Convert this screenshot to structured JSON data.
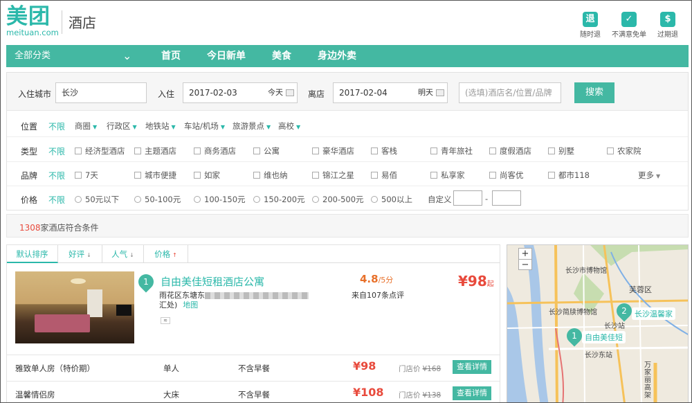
{
  "header": {
    "logo_cn": "美团",
    "logo_en": "meituan.com",
    "title": "酒店",
    "icons": [
      {
        "glyph": "退",
        "label": "随时退",
        "icon": "refund-icon"
      },
      {
        "glyph": "✓",
        "label": "不满意免单",
        "icon": "check-icon"
      },
      {
        "glyph": "$",
        "label": "过期退",
        "icon": "expire-refund-icon"
      }
    ]
  },
  "nav": {
    "all_label": "全部分类",
    "links": [
      "首页",
      "今日新单",
      "美食",
      "身边外卖"
    ]
  },
  "search": {
    "city_label": "入住城市",
    "city_value": "长沙",
    "checkin_label": "入住",
    "checkin_value": "2017-02-03",
    "checkin_tag": "今天",
    "checkout_label": "离店",
    "checkout_value": "2017-02-04",
    "checkout_tag": "明天",
    "keyword_placeholder": "(选填)酒店名/位置/品牌",
    "button": "搜索"
  },
  "filters": {
    "all_label": "不限",
    "location": {
      "label": "位置",
      "options": [
        "商圈",
        "行政区",
        "地铁站",
        "车站/机场",
        "旅游景点",
        "高校"
      ]
    },
    "type": {
      "label": "类型",
      "options": [
        "经济型酒店",
        "主题酒店",
        "商务酒店",
        "公寓",
        "豪华酒店",
        "客栈",
        "青年旅社",
        "度假酒店",
        "别墅",
        "农家院"
      ]
    },
    "brand": {
      "label": "品牌",
      "options": [
        "7天",
        "城市便捷",
        "如家",
        "维也纳",
        "锦江之星",
        "易佰",
        "私享家",
        "尚客优",
        "都市118"
      ],
      "more": "更多"
    },
    "price": {
      "label": "价格",
      "options": [
        "50元以下",
        "50-100元",
        "100-150元",
        "150-200元",
        "200-500元",
        "500以上"
      ],
      "custom_label": "自定义",
      "dash": "-"
    }
  },
  "results": {
    "count": "1308",
    "count_suffix": "家酒店符合条件"
  },
  "sort_tabs": [
    {
      "label": "默认排序",
      "arrow": ""
    },
    {
      "label": "好评",
      "arrow": "↓"
    },
    {
      "label": "人气",
      "arrow": "↓"
    },
    {
      "label": "价格",
      "arrow": "↑"
    }
  ],
  "hotel": {
    "index": "1",
    "name": "自由美佳短租酒店公寓",
    "address_prefix": "雨花区东塘东",
    "address_suffix": "汇处)",
    "map_link": "地图",
    "score": "4.8",
    "score_suffix": "/5分",
    "reviews": "来自107条点评",
    "price": "¥98",
    "price_suffix": "起"
  },
  "rooms": [
    {
      "name": "雅致单人房（特价期）",
      "bed": "单人",
      "breakfast": "不含早餐",
      "price": "¥98",
      "store_label": "门店价",
      "store_price": "¥168",
      "button": "查看详情"
    },
    {
      "name": "温馨情侣房",
      "bed": "大床",
      "breakfast": "不含早餐",
      "price": "¥108",
      "store_label": "门店价",
      "store_price": "¥138",
      "button": "查看详情"
    }
  ],
  "map": {
    "zoom_in": "+",
    "zoom_out": "−",
    "labels": [
      "长沙市博物馆",
      "芙蓉区",
      "长沙简牍博物馆",
      "长沙站",
      "长沙东站",
      "万家丽高架"
    ],
    "pins": [
      {
        "index": "1",
        "label": "自由美佳短"
      },
      {
        "index": "2",
        "label": "长沙温馨家"
      }
    ]
  },
  "colors": {
    "accent": "#44b8a2",
    "price": "#e84a3c",
    "score": "#e8702a"
  }
}
